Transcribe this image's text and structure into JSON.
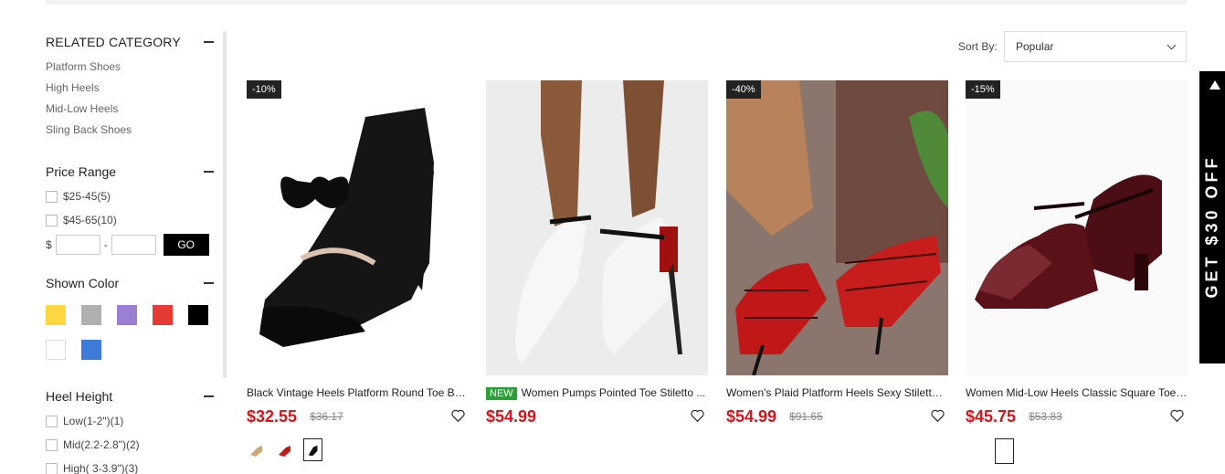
{
  "sidebar": {
    "related": {
      "title": "RELATED CATEGORY",
      "items": [
        "Platform Shoes",
        "High Heels",
        "Mid-Low Heels",
        "Sling Back Shoes"
      ]
    },
    "price": {
      "title": "Price Range",
      "options": [
        "$25-45(5)",
        "$45-65(10)"
      ],
      "currency": "$",
      "separator": "-",
      "go_label": "GO"
    },
    "color": {
      "title": "Shown Color",
      "swatches": [
        "#ffd740",
        "#b0b0b0",
        "#9b7fd4",
        "#e53935",
        "#000000",
        "#ffffff",
        "#3e7bd9"
      ]
    },
    "heel": {
      "title": "Heel Height",
      "options": [
        "Low(1-2\")(1)",
        "Mid(2.2-2.8\")(2)",
        "High( 3-3.9\")(3)"
      ]
    }
  },
  "sort": {
    "label": "Sort By:",
    "value": "Popular"
  },
  "products": [
    {
      "discount": "-10%",
      "title": "Black Vintage Heels Platform Round Toe Bo...",
      "price": "$32.55",
      "old_price": "$36.17"
    },
    {
      "badge": "NEW",
      "title": "Women Pumps Pointed Toe Stiletto ...",
      "price": "$54.99"
    },
    {
      "discount": "-40%",
      "title": "Women's Plaid Platform Heels Sexy Stiletto ...",
      "price": "$54.99",
      "old_price": "$91.65"
    },
    {
      "discount": "-15%",
      "title": "Women Mid-Low Heels Classic Square Toe ...",
      "price": "$45.75",
      "old_price": "$53.83"
    }
  ],
  "promo": {
    "text": "GET $30 OFF"
  },
  "colors": {
    "price_red": "#d0171e",
    "new_badge": "#2e9e3b",
    "discount_bg": "#222222"
  }
}
